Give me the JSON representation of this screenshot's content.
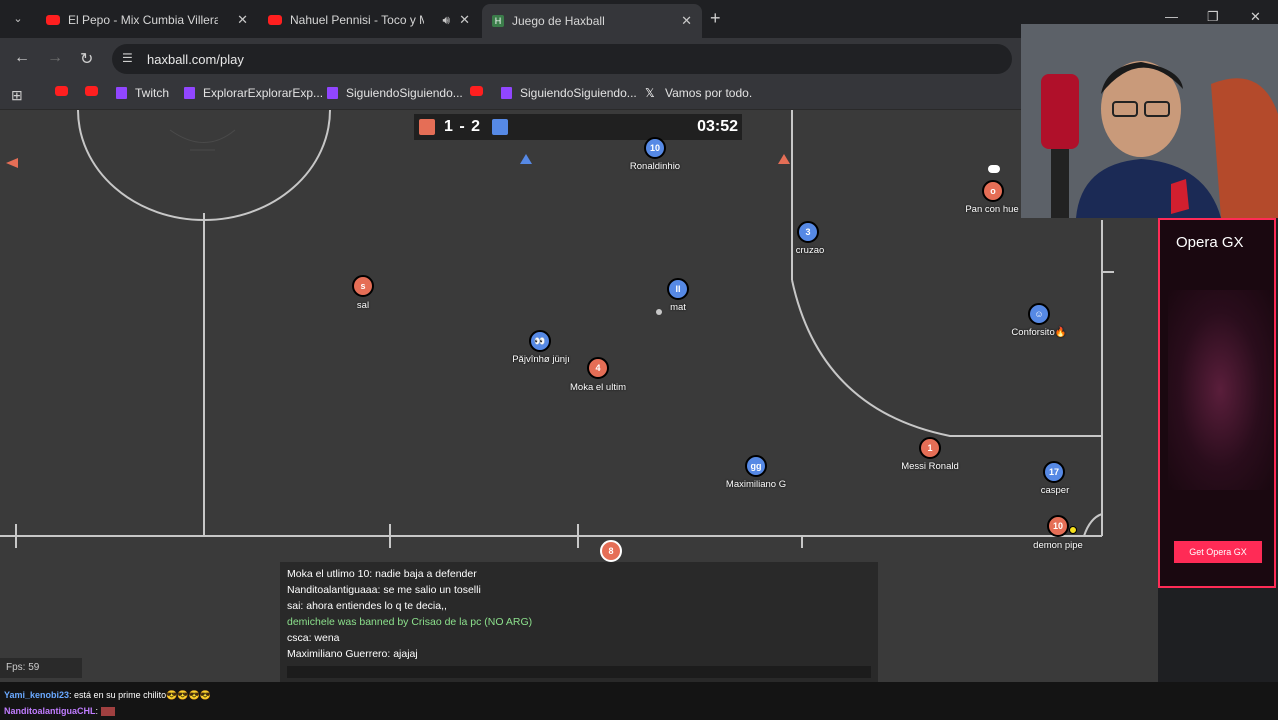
{
  "browser": {
    "tabs": [
      {
        "title": "El Pepo - Mix Cumbia Villera (E",
        "icon": "youtube-icon",
        "active": false
      },
      {
        "title": "Nahuel Pennisi - Toco y Me",
        "icon": "youtube-icon",
        "active": false,
        "audio": true
      },
      {
        "title": "Juego de Haxball",
        "icon": "haxball-icon",
        "active": true
      }
    ],
    "url": "haxball.com/play",
    "bookmarks": [
      {
        "label": "",
        "icon": "youtube-icon"
      },
      {
        "label": "",
        "icon": "youtube-icon"
      },
      {
        "label": "Twitch",
        "icon": "twitch-icon"
      },
      {
        "label": "ExplorarExplorarExp...",
        "icon": "twitch-icon"
      },
      {
        "label": "SiguiendoSiguiendo...",
        "icon": "twitch-icon"
      },
      {
        "label": "",
        "icon": "youtube-icon"
      },
      {
        "label": "SiguiendoSiguiendo...",
        "icon": "twitch-icon"
      },
      {
        "label": "Vamos por todo.",
        "icon": "x-icon"
      }
    ]
  },
  "game": {
    "score": "1 - 2",
    "time": "03:52",
    "team_colors": {
      "red": "#e56e56",
      "blue": "#5689e5"
    },
    "players": [
      {
        "team": "blue",
        "avatar": "10",
        "name": "Ronaldinhio"
      },
      {
        "team": "red",
        "avatar": "o",
        "name": "Pan con hue"
      },
      {
        "team": "blue",
        "avatar": "3",
        "name": "cruzao"
      },
      {
        "team": "red",
        "avatar": "s",
        "name": "sal"
      },
      {
        "team": "blue",
        "avatar": "II",
        "name": "mat"
      },
      {
        "team": "blue",
        "avatar": "☺",
        "name": "Conforsito🔥"
      },
      {
        "team": "blue",
        "avatar": "👀",
        "name": "Păjvînhø jünjı"
      },
      {
        "team": "red",
        "avatar": "4",
        "name": "Moka el ultim"
      },
      {
        "team": "red",
        "avatar": "1",
        "name": "Messi Ronald"
      },
      {
        "team": "blue",
        "avatar": "gg",
        "name": "Maximiliano G"
      },
      {
        "team": "blue",
        "avatar": "17",
        "name": "casper"
      },
      {
        "team": "red",
        "avatar": "10",
        "name": "demon pipe"
      },
      {
        "team": "red",
        "avatar": "8",
        "name": ""
      }
    ],
    "chat": [
      {
        "text": "Moka el utlimo 10: nadie baja a defender",
        "system": false
      },
      {
        "text": "Nanditoalantiguaaa: se me salio un toselli",
        "system": false
      },
      {
        "text": "sai: ahora entiendes lo q te decia,,",
        "system": false
      },
      {
        "text": "demichele was banned by Crisao de la pc (NO ARG)",
        "system": true
      },
      {
        "text": "csca: wena",
        "system": false
      },
      {
        "text": "Maximiliano Guerrero: ajajaj",
        "system": false
      }
    ],
    "fps": "Fps: 59"
  },
  "ad": {
    "brand": "Opera GX",
    "cta": "Get Opera GX"
  },
  "stream_chat": [
    {
      "user": "Yami_kenobi23",
      "text": ": está en su prime chilito😎😎😎😎"
    },
    {
      "user": "NanditoalantiguaCHL",
      "text": ":"
    }
  ]
}
